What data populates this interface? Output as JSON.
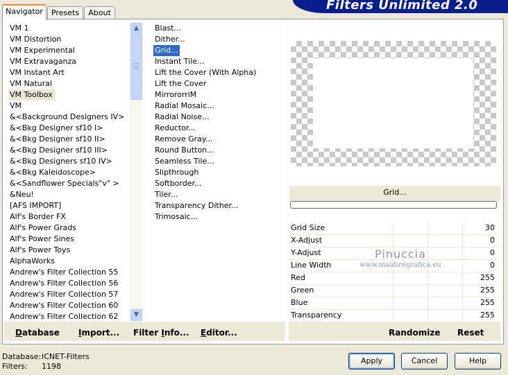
{
  "tabs": [
    {
      "label": "Navigator",
      "active": true
    },
    {
      "label": "Presets",
      "active": false
    },
    {
      "label": "About",
      "active": false
    }
  ],
  "banner": {
    "title": "Filters Unlimited 2.0"
  },
  "categories": [
    "VM 1",
    "VM Distortion",
    "VM Experimental",
    "VM Extravaganza",
    "VM Instant Art",
    "VM Natural",
    "VM Toolbox",
    "VM",
    "&<Background Designers IV>",
    "&<Bkg Designer sf10 I>",
    "&<Bkg Designer sf10 II>",
    "&<Bkg Designer sf10 III>",
    "&<Bkg Designers sf10 IV>",
    "&<Bkg Kaleidoscope>",
    "&<Sandflower Specials\"v\" >",
    "&Neu!",
    "[AFS IMPORT]",
    "Alf's Border FX",
    "Alf's Power Grads",
    "Alf's Power Sines",
    "Alf's Power Toys",
    "AlphaWorks",
    "Andrew's Filter Collection 55",
    "Andrew's Filter Collection 56",
    "Andrew's Filter Collection 57",
    "Andrew's Filter Collection 60",
    "Andrew's Filter Collection 62"
  ],
  "selected_category": "VM Toolbox",
  "filters": [
    "Blast...",
    "Dither...",
    "Grid...",
    "Instant Tile...",
    "Lift the Cover (With Alpha)",
    "Lift the Cover",
    "MirrororriM",
    "Radial Mosaic...",
    "Radial Noise...",
    "Reductor...",
    "Remove Gray...",
    "Round Button...",
    "Seamless Tile...",
    "Slipthrough",
    "Softborder...",
    "Tiler...",
    "Transparency Dither...",
    "Trimosaic..."
  ],
  "selected_filter": "Grid...",
  "filter_name": "Grid...",
  "params": [
    {
      "label": "Grid Size",
      "value": "30"
    },
    {
      "label": "X-Adjust",
      "value": "0"
    },
    {
      "label": "Y-Adjust",
      "value": "0"
    },
    {
      "label": "Line Width",
      "value": "0"
    },
    {
      "label": "Red",
      "value": "255"
    },
    {
      "label": "Green",
      "value": "255"
    },
    {
      "label": "Blue",
      "value": "255"
    },
    {
      "label": "Transparency",
      "value": "255"
    }
  ],
  "watermark": {
    "line1": "Pinuccia",
    "line2": "www.maidiregrafica.eu"
  },
  "left_actions": {
    "database": {
      "underline": "D",
      "rest": "atabase"
    },
    "import": {
      "underline": "I",
      "rest": "mport..."
    },
    "filter_info": {
      "pre": "Filter ",
      "underline": "I",
      "rest": "nfo..."
    },
    "editor": {
      "underline": "E",
      "rest": "ditor..."
    }
  },
  "right_actions": {
    "randomize": "Randomize",
    "reset": "Reset"
  },
  "status": {
    "database_label": "Database:",
    "database_value": "ICNET-Filters",
    "filters_label": "Filters:",
    "filters_value": "1198"
  },
  "buttons": {
    "apply": "Apply",
    "cancel": "Cancel",
    "help": "Help"
  },
  "icons": {
    "scroll_up": "chevron-up-icon",
    "scroll_down": "chevron-down-icon"
  }
}
